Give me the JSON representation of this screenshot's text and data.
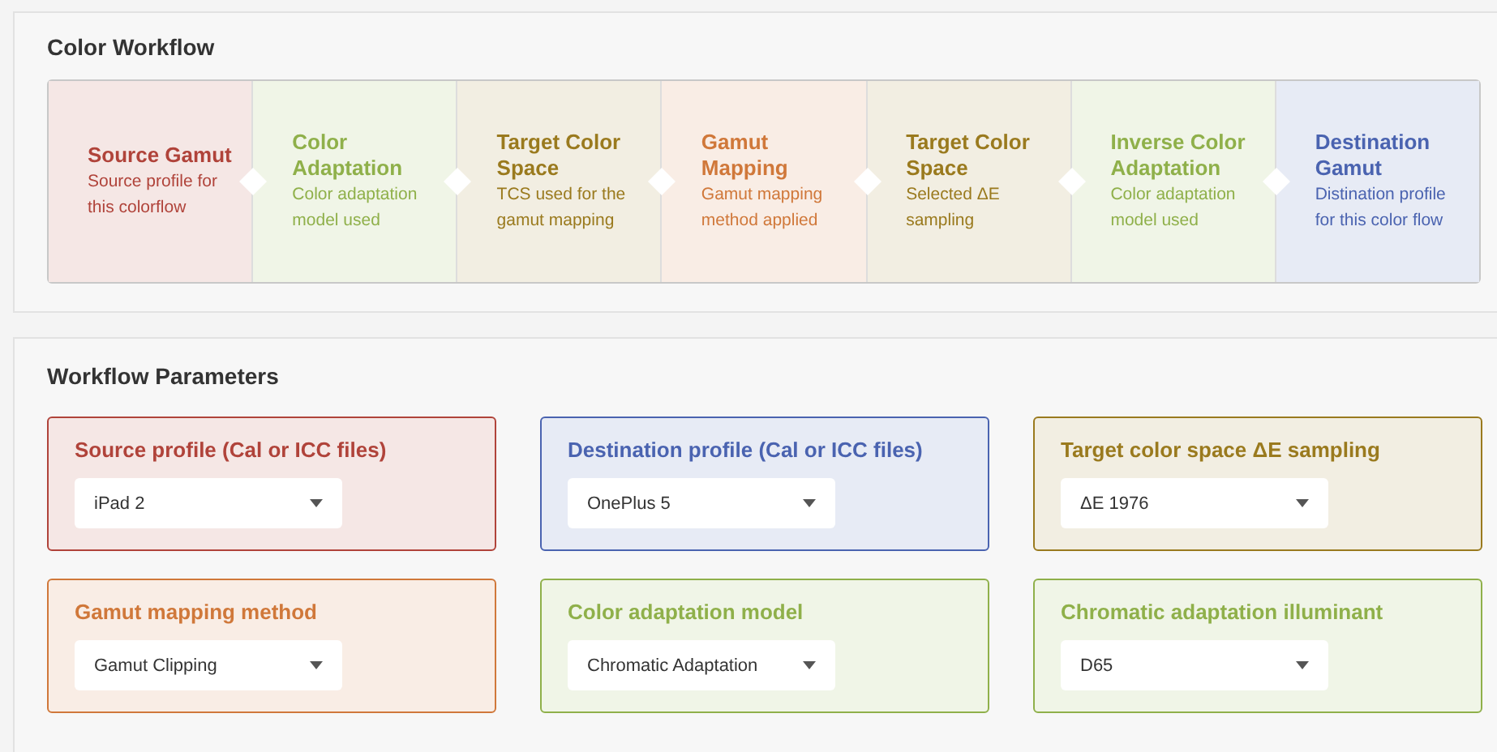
{
  "workflow": {
    "title": "Color Workflow",
    "steps": [
      {
        "title": "Source Gamut",
        "description": "Source profile for this colorflow",
        "color": "#b0433a"
      },
      {
        "title": "Color Adaptation",
        "description": "Color adaptation model used",
        "color": "#8fb04a"
      },
      {
        "title": "Target Color Space",
        "description": "TCS used for the gamut mapping",
        "color": "#9a7a1e"
      },
      {
        "title": "Gamut Mapping",
        "description": "Gamut mapping method applied",
        "color": "#d0783a"
      },
      {
        "title": "Target Color Space",
        "description": "Selected ΔE sampling",
        "color": "#9a7a1e"
      },
      {
        "title": "Inverse Color Adaptation",
        "description": "Color adaptation model used",
        "color": "#8fb04a"
      },
      {
        "title": "Destination Gamut",
        "description": "Distination profile for this color flow",
        "color": "#4a63b0"
      }
    ]
  },
  "parameters": {
    "title": "Workflow Parameters",
    "fields": [
      {
        "label": "Source profile (Cal or ICC files)",
        "value": "iPad 2",
        "color": "#b0433a"
      },
      {
        "label": "Destination profile (Cal or ICC files)",
        "value": "OnePlus 5",
        "color": "#4a63b0"
      },
      {
        "label": "Target color space **ΔE** sampling",
        "value": "ΔE 1976",
        "color": "#9a7a1e"
      },
      {
        "label": "Gamut mapping method",
        "value": "Gamut Clipping",
        "color": "#d0783a"
      },
      {
        "label": "Color adaptation model",
        "value": "Chromatic Adaptation",
        "color": "#8fb04a"
      },
      {
        "label": "Chromatic adaptation illuminant",
        "value": "D65",
        "color": "#8fb04a"
      }
    ]
  }
}
